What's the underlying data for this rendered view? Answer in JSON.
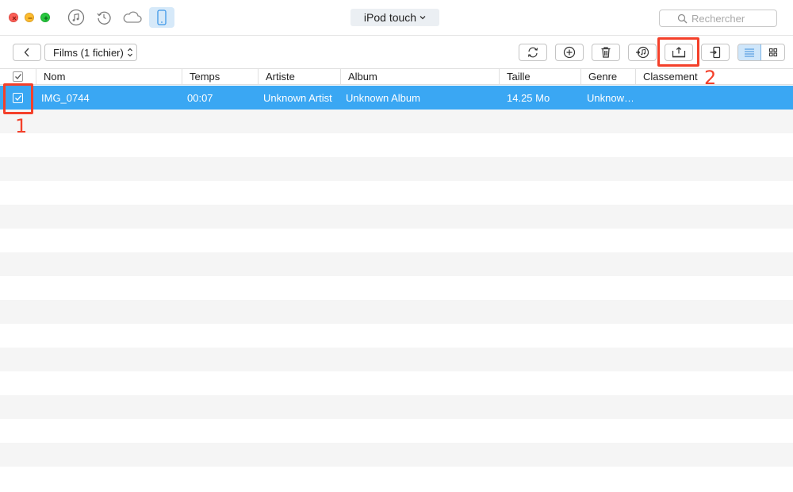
{
  "titlebar": {
    "device_name": "iPod touch",
    "search_placeholder": "Rechercher",
    "icons": [
      "music-icon",
      "restore-icon",
      "cloud-icon",
      "device-icon"
    ]
  },
  "toolbar": {
    "folder_label": "Films (1 fichier)",
    "buttons": [
      "refresh",
      "add",
      "delete",
      "to-itunes",
      "export-to-computer",
      "export-to-device"
    ],
    "views": [
      "list",
      "grid"
    ],
    "active_view": "list"
  },
  "table": {
    "columns": [
      "Nom",
      "Temps",
      "Artiste",
      "Album",
      "Taille",
      "Genre",
      "Classement"
    ],
    "rows": [
      {
        "checked": true,
        "selected": true,
        "nom": "IMG_0744",
        "temps": "00:07",
        "artiste": "Unknown Artist",
        "album": "Unknown Album",
        "taille": "14.25 Mo",
        "genre": "Unknow…",
        "classement": ""
      }
    ]
  },
  "annotations": {
    "step1": "1",
    "step2": "2",
    "color": "#f4402a"
  },
  "colors": {
    "selection": "#3aa7f3",
    "active_tab_bg": "#d6e9f9",
    "alt_row": "#f5f5f5"
  }
}
